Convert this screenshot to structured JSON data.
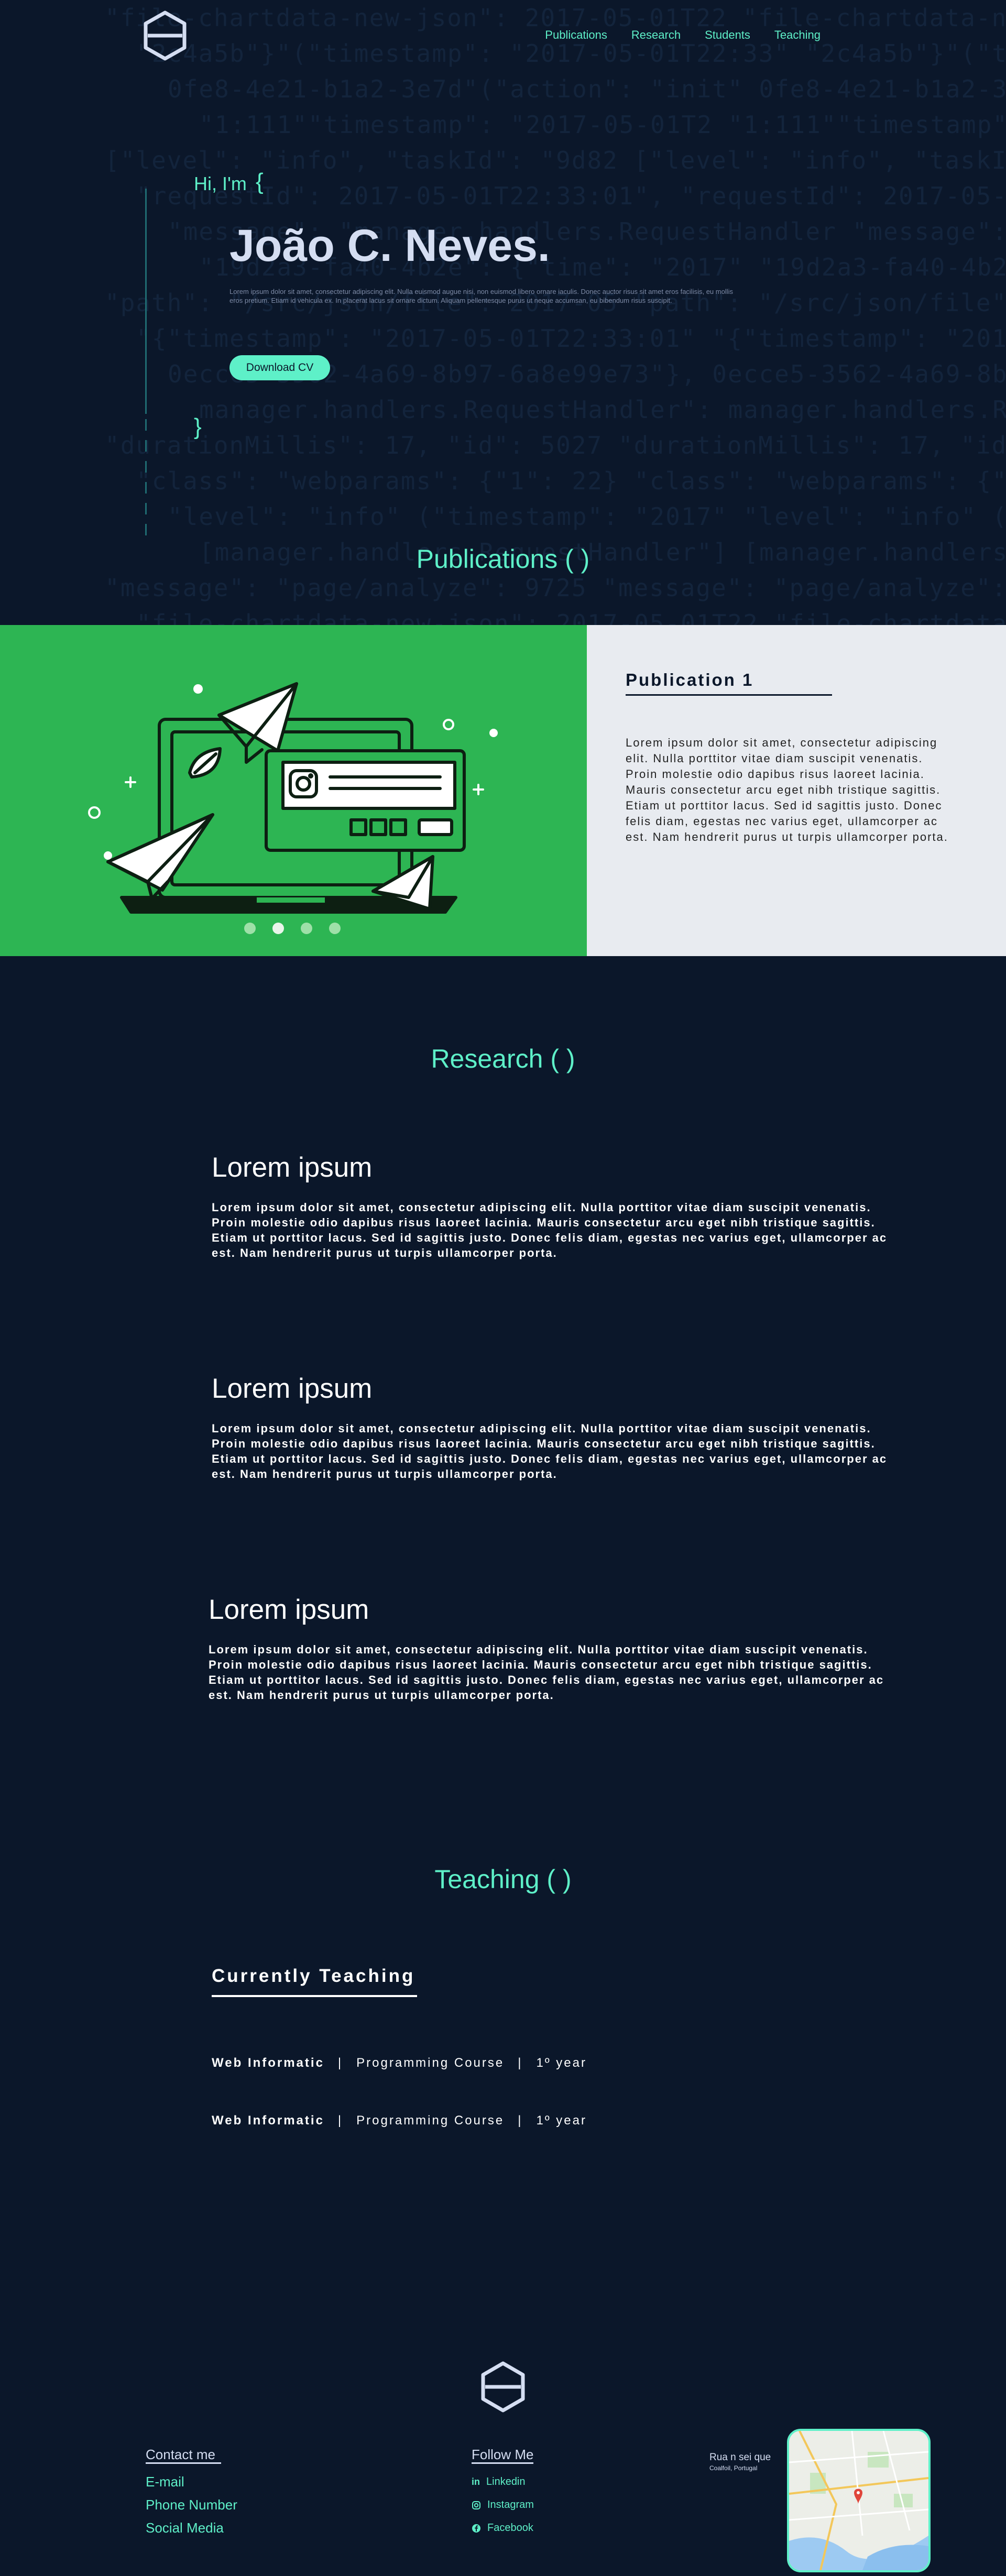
{
  "nav": {
    "logo_alt": "hexagon-logo",
    "items": [
      "Publications",
      "Research",
      "Students",
      "Teaching"
    ]
  },
  "hero": {
    "greeting": "Hi, I'm",
    "brace_open": "{",
    "brace_close": "}",
    "name": "João C. Neves.",
    "intro": "Lorem ipsum dolor sit amet, consectetur adipiscing elit. Nulla euismod augue nisi, non euismod libero ornare iaculis. Donec auctor risus sit amet eros facilisis, eu mollis eros pretium. Etiam id vehicula ex. In placerat lacus sit ornare dictum. Aliquam pellentesque purus ut neque accumsan, eu bibendum risus suscipit.",
    "cv_button": "Download CV"
  },
  "sections": {
    "publications": "Publications ( )",
    "research": "Research ( )",
    "teaching": "Teaching ( )"
  },
  "publication": {
    "title": "Publication 1",
    "text": "Lorem ipsum dolor sit amet, consectetur adipiscing elit. Nulla porttitor vitae diam suscipit venenatis. Proin molestie odio dapibus risus laoreet lacinia. Mauris consectetur arcu eget nibh tristique sagittis. Etiam ut porttitor lacus. Sed id sagittis justo. Donec felis diam, egestas nec varius eget, ullamcorper ac est. Nam hendrerit purus ut turpis ullamcorper porta.",
    "carousel_count": 4,
    "carousel_active": 1
  },
  "research": [
    {
      "title": "Lorem ipsum",
      "text": "Lorem ipsum dolor sit amet, consectetur adipiscing elit. Nulla porttitor vitae diam suscipit venenatis. Proin molestie odio dapibus risus laoreet lacinia. Mauris consectetur arcu eget nibh tristique sagittis. Etiam ut porttitor lacus. Sed id sagittis justo. Donec felis diam, egestas nec varius eget, ullamcorper ac est. Nam hendrerit purus ut turpis ullamcorper porta."
    },
    {
      "title": "Lorem ipsum",
      "text": "Lorem ipsum dolor sit amet, consectetur adipiscing elit. Nulla porttitor vitae diam suscipit venenatis. Proin molestie odio dapibus risus laoreet lacinia. Mauris consectetur arcu eget nibh tristique sagittis. Etiam ut porttitor lacus. Sed id sagittis justo. Donec felis diam, egestas nec varius eget, ullamcorper ac est. Nam hendrerit purus ut turpis ullamcorper porta."
    },
    {
      "title": "Lorem ipsum",
      "text": "Lorem ipsum dolor sit amet, consectetur adipiscing elit. Nulla porttitor vitae diam suscipit venenatis. Proin molestie odio dapibus risus laoreet lacinia. Mauris consectetur arcu eget nibh tristique sagittis. Etiam ut porttitor lacus. Sed id sagittis justo. Donec felis diam, egestas nec varius eget, ullamcorper ac est. Nam hendrerit purus ut turpis ullamcorper porta."
    }
  ],
  "teaching": {
    "heading": "Currently Teaching",
    "courses": [
      {
        "name": "Web Informatic",
        "type": "Programming Course",
        "year": "1º year"
      },
      {
        "name": "Web Informatic",
        "type": "Programming Course",
        "year": "1º year"
      }
    ],
    "separator": "|"
  },
  "footer": {
    "contact_title": "Contact me",
    "contact_links": [
      "E-mail",
      "Phone Number",
      "Social Media"
    ],
    "follow_title": "Follow Me",
    "social": [
      {
        "icon": "linkedin-icon",
        "label": "Linkedin"
      },
      {
        "icon": "instagram-icon",
        "label": "Instagram"
      },
      {
        "icon": "facebook-icon",
        "label": "Facebook"
      }
    ],
    "address_line1": "Rua n sei que",
    "address_line2": "Coalfoil, Portugal"
  },
  "colors": {
    "background": "#0b172a",
    "accent": "#5ef0c8",
    "publication_green": "#2db553",
    "publication_panel": "#e8ebf0",
    "heading_light": "#d5def2"
  },
  "code_background": [
    "\"file-chartdata-new-json\": 2017-05-01T22",
    "\"2c4a5b\"}\"(\"timestamp\": \"2017-05-01T22:33\"",
    "0fe8-4e21-b1a2-3e7d\"(\"action\": \"init\"",
    "\"1:111\"\"timestamp\": \"2017-05-01T2",
    "[\"level\": \"info\", \"taskId\": \"9d82",
    "\"requestId\": 2017-05-01T22:33:01\",",
    "\"message\": \"manager.handlers.RequestHandler",
    "\"19d2a3-fa40-4b2e\": {\"time\": \"2017\"",
    "\"path\": \"/src/json/file\": 2017-05",
    "\"{\"timestamp\": \"2017-05-01T22:33:01\"",
    "0ecce5-3562-4a69-8b97-6a8e99e73\"},",
    "manager.handlers.RequestHandler\":",
    "\"durationMillis\": 17, \"id\": 5027",
    "\"class\": \"webparams\": {\"1\": 22}",
    "\"level\": \"info\" (\"timestamp\": \"2017\"",
    "[manager.handlers.RequestHandler\"]",
    "\"message\": \"page/analyze\": 9725"
  ]
}
